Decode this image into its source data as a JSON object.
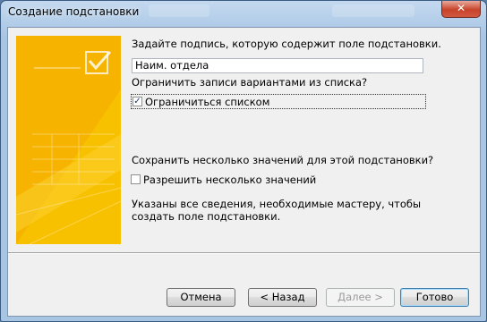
{
  "window": {
    "title": "Создание подстановки",
    "close_glyph": "✕"
  },
  "wizard": {
    "caption_prompt": "Задайте подпись, которую содержит поле подстановки.",
    "caption_value": "Наим. отдела",
    "limit_prompt": "Ограничить записи вариантами из списка?",
    "limit_checkbox": {
      "label": "Ограничиться списком",
      "checked": true
    },
    "multi_prompt": "Сохранить несколько значений для этой подстановки?",
    "multi_checkbox": {
      "label": "Разрешить несколько значений",
      "checked": false
    },
    "info_text": "Указаны все сведения, необходимые мастеру, чтобы создать поле подстановки."
  },
  "buttons": {
    "cancel": "Отмена",
    "back": "< Назад",
    "next": "Далее >",
    "finish": "Готово"
  },
  "art": {
    "icon": "checklist-illustration",
    "bg_color": "#f6b400",
    "accent": "#ffd24a"
  }
}
